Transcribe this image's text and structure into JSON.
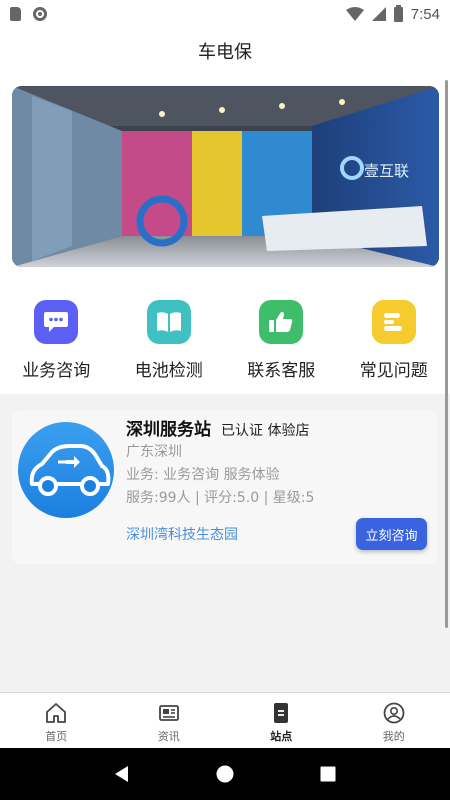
{
  "status_bar": {
    "time": "7:54"
  },
  "header": {
    "title": "车电保"
  },
  "banner": {
    "sign_text": "壹互联"
  },
  "quick_menu": [
    {
      "label": "业务咨询",
      "icon": "chat-bubble-icon",
      "color": "#5b5ff3"
    },
    {
      "label": "电池检测",
      "icon": "book-icon",
      "color": "#3fc0c3"
    },
    {
      "label": "联系客服",
      "icon": "thumbs-up-icon",
      "color": "#3ebd6a"
    },
    {
      "label": "常见问题",
      "icon": "list-icon",
      "color": "#f5cb2e"
    }
  ],
  "station": {
    "name": "深圳服务站",
    "tags": "已认证 体验店",
    "region": "广东深圳",
    "business": "业务: 业务咨询 服务体验",
    "stats": "服务:99人 | 评分:5.0 | 星级:5",
    "address": "深圳湾科技生态园",
    "consult_label": "立刻咨询"
  },
  "tabs": [
    {
      "label": "首页",
      "icon": "home-icon",
      "active": false
    },
    {
      "label": "资讯",
      "icon": "news-icon",
      "active": false
    },
    {
      "label": "站点",
      "icon": "station-icon",
      "active": true
    },
    {
      "label": "我的",
      "icon": "profile-icon",
      "active": false
    }
  ],
  "colors": {
    "accent": "#3a63e0",
    "link": "#4a90d9"
  }
}
